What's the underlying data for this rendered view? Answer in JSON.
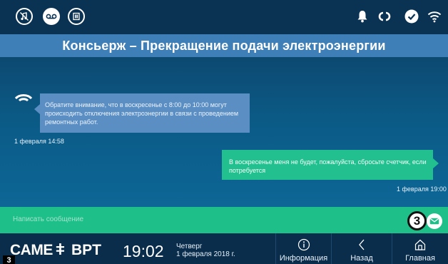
{
  "title": "Консьерж – Прекращение подачи электроэнергии",
  "topbar": {
    "left_icons": [
      "mute-ringtone-icon",
      "answering-machine-icon",
      "door-open-icon"
    ],
    "right_icons": [
      "bell-icon",
      "sync-icon",
      "checkmark-icon",
      "wifi-icon"
    ]
  },
  "messages": [
    {
      "direction": "incoming",
      "text": "Обратите внимание, что в воскресенье с 8:00 до 10:00 могут происходить отключения электроэнергии в связи с проведением ремонтных работ.",
      "timestamp": "1 февраля 14:58"
    },
    {
      "direction": "outgoing",
      "text": "В воскресенье меня не будет, пожалуйста, сбросьте счетчик, если потребуется",
      "timestamp": "1 февраля 19:00"
    }
  ],
  "composer": {
    "placeholder": "Написать сообщение",
    "callout": "3"
  },
  "bottom": {
    "brand": "CAME",
    "brand_suffix": "BPT",
    "time": "19:02",
    "weekday": "Четверг",
    "date": "1 февраля 2018 г.",
    "info_label": "Информация",
    "back_label": "Назад",
    "home_label": "Главная",
    "corner_badge": "3"
  },
  "colors": {
    "title_bar": "#3f7fb8",
    "incoming_bubble": "#5b8fc4",
    "outgoing_bubble": "#22c08e",
    "composer": "#1fbf8a",
    "bottom_bar": "#0a2d4b"
  }
}
